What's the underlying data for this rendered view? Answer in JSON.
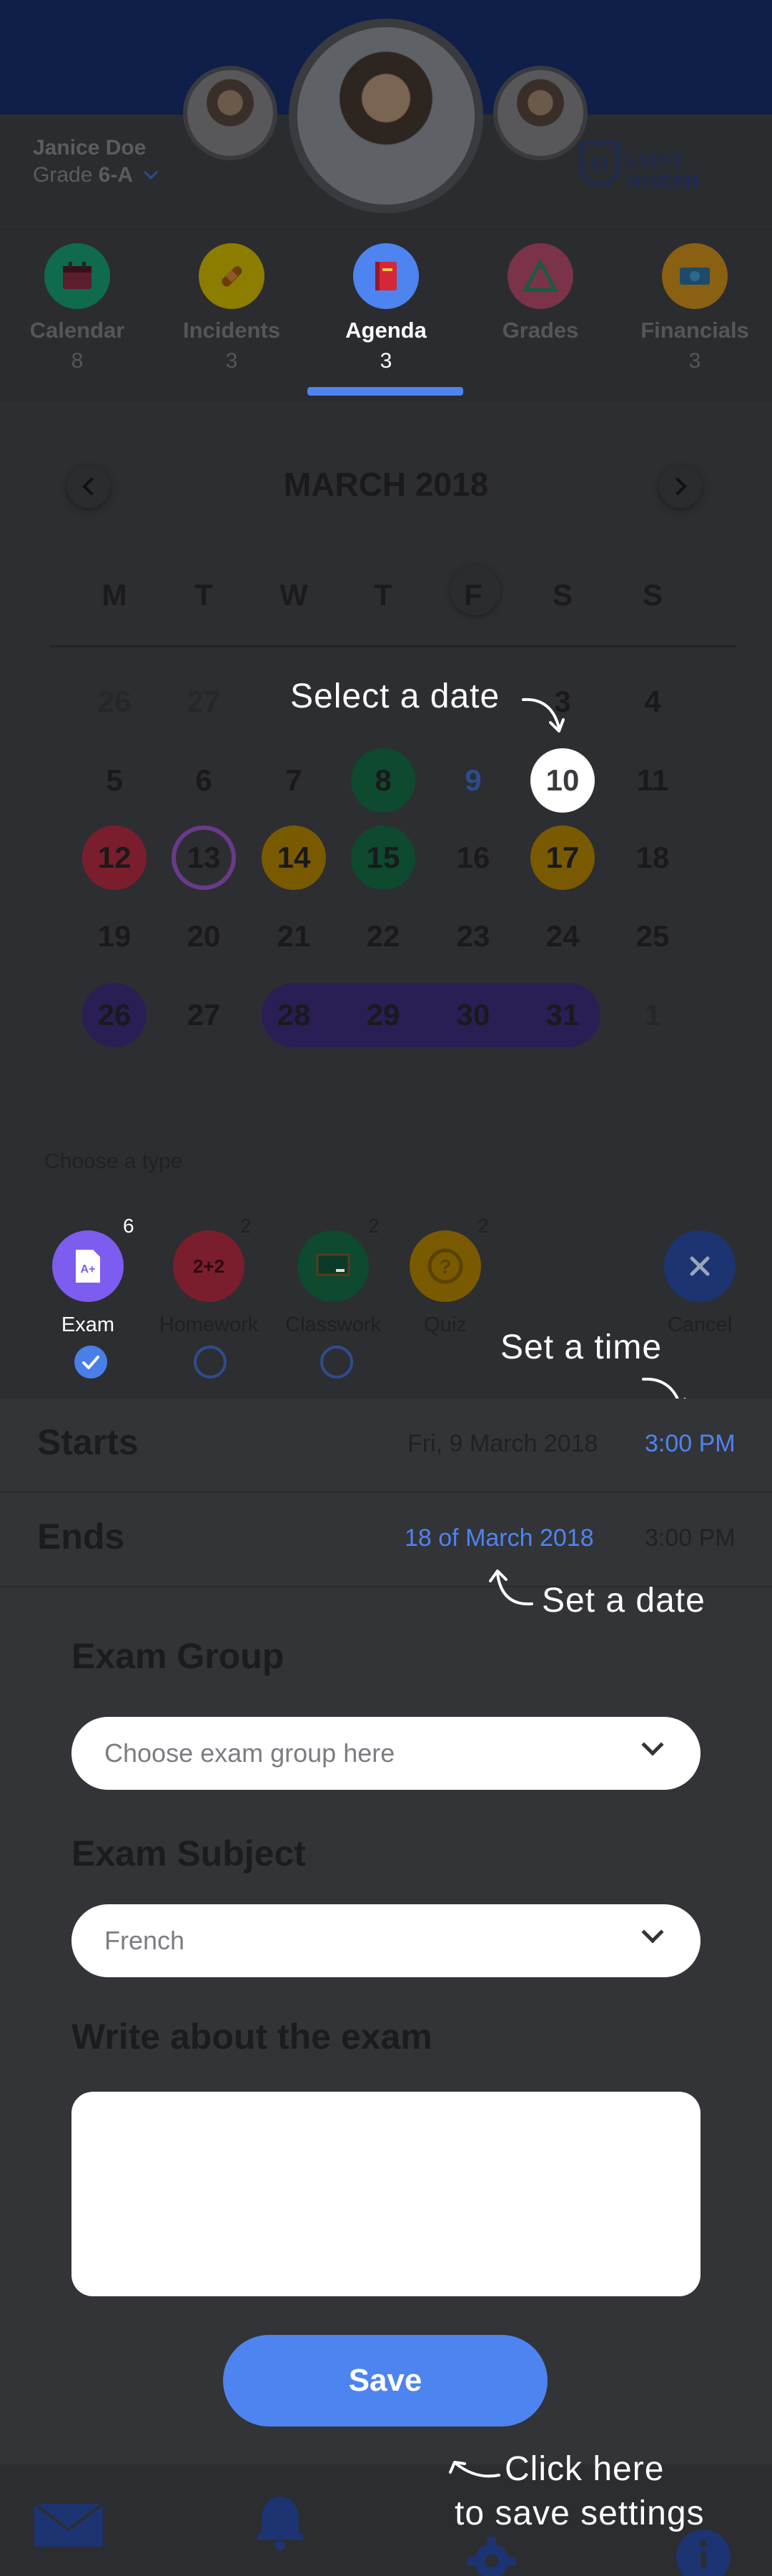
{
  "profile": {
    "name": "Janice Doe",
    "grade_prefix": "Grade",
    "grade_value": "6-A"
  },
  "school_logo": {
    "initials": "SJ",
    "name": "SAINT JOSEPH",
    "subtitle": "SCHOOL"
  },
  "tabs": [
    {
      "label": "Calendar",
      "count": "8",
      "icon": "calendar-icon",
      "color": "#0f6a4e"
    },
    {
      "label": "Incidents",
      "count": "3",
      "icon": "bandage-icon",
      "color": "#8c7c00"
    },
    {
      "label": "Agenda",
      "count": "3",
      "icon": "book-icon",
      "color": "#4e84f0",
      "active": true
    },
    {
      "label": "Grades",
      "count": "",
      "icon": "triangle-ruler-icon",
      "color": "#7a3348"
    },
    {
      "label": "Financials",
      "count": "3",
      "icon": "money-icon",
      "color": "#8a6012"
    }
  ],
  "calendar": {
    "month_label": "MARCH 2018",
    "weekdays": [
      "M",
      "T",
      "W",
      "T",
      "F",
      "S",
      "S"
    ],
    "weeks": [
      [
        "26",
        "27",
        "28",
        "1",
        "2",
        "3",
        "4"
      ],
      [
        "5",
        "6",
        "7",
        "8",
        "9",
        "10",
        "11"
      ],
      [
        "12",
        "13",
        "14",
        "15",
        "16",
        "17",
        "18"
      ],
      [
        "19",
        "20",
        "21",
        "22",
        "23",
        "24",
        "25"
      ],
      [
        "26",
        "27",
        "28",
        "29",
        "30",
        "31",
        "1"
      ]
    ]
  },
  "tooltips": {
    "select_date": "Select a date",
    "set_time": "Set a time",
    "set_date": "Set a date",
    "click_here_1": "Click here",
    "click_here_2": "to save settings"
  },
  "type_chooser": {
    "prompt": "Choose a type",
    "types": [
      {
        "label": "Exam",
        "badge": "6",
        "icon": "exam-icon",
        "color": "#7d5cf0",
        "selected": true
      },
      {
        "label": "Homework",
        "badge": "2",
        "icon": "homework-icon",
        "color": "#7a1e2e"
      },
      {
        "label": "Classwork",
        "badge": "2",
        "icon": "classwork-icon",
        "color": "#0d4a30"
      },
      {
        "label": "Quiz",
        "badge": "2",
        "icon": "quiz-icon",
        "color": "#7a5a00"
      }
    ],
    "cancel_label": "Cancel",
    "cancel_icon": "close-icon"
  },
  "schedule": {
    "starts_label": "Starts",
    "starts_date": "Fri, 9 March 2018",
    "starts_time": "3:00 PM",
    "ends_label": "Ends",
    "ends_date": "18 of March 2018",
    "ends_time": "3:00 PM"
  },
  "form": {
    "exam_group_label": "Exam Group",
    "exam_group_placeholder": "Choose exam group here",
    "exam_subject_label": "Exam Subject",
    "exam_subject_value": "French",
    "description_label": "Write about the exam",
    "description_value": "",
    "save_label": "Save"
  },
  "bottom_nav": [
    {
      "icon": "mail-icon"
    },
    {
      "icon": "bell-icon"
    },
    {
      "icon": "gear-icon"
    },
    {
      "icon": "info-icon"
    }
  ],
  "colors": {
    "accent": "#4e84f0",
    "overlay_bg": "#2e2f32",
    "tooltip_text": "#ffffff"
  }
}
